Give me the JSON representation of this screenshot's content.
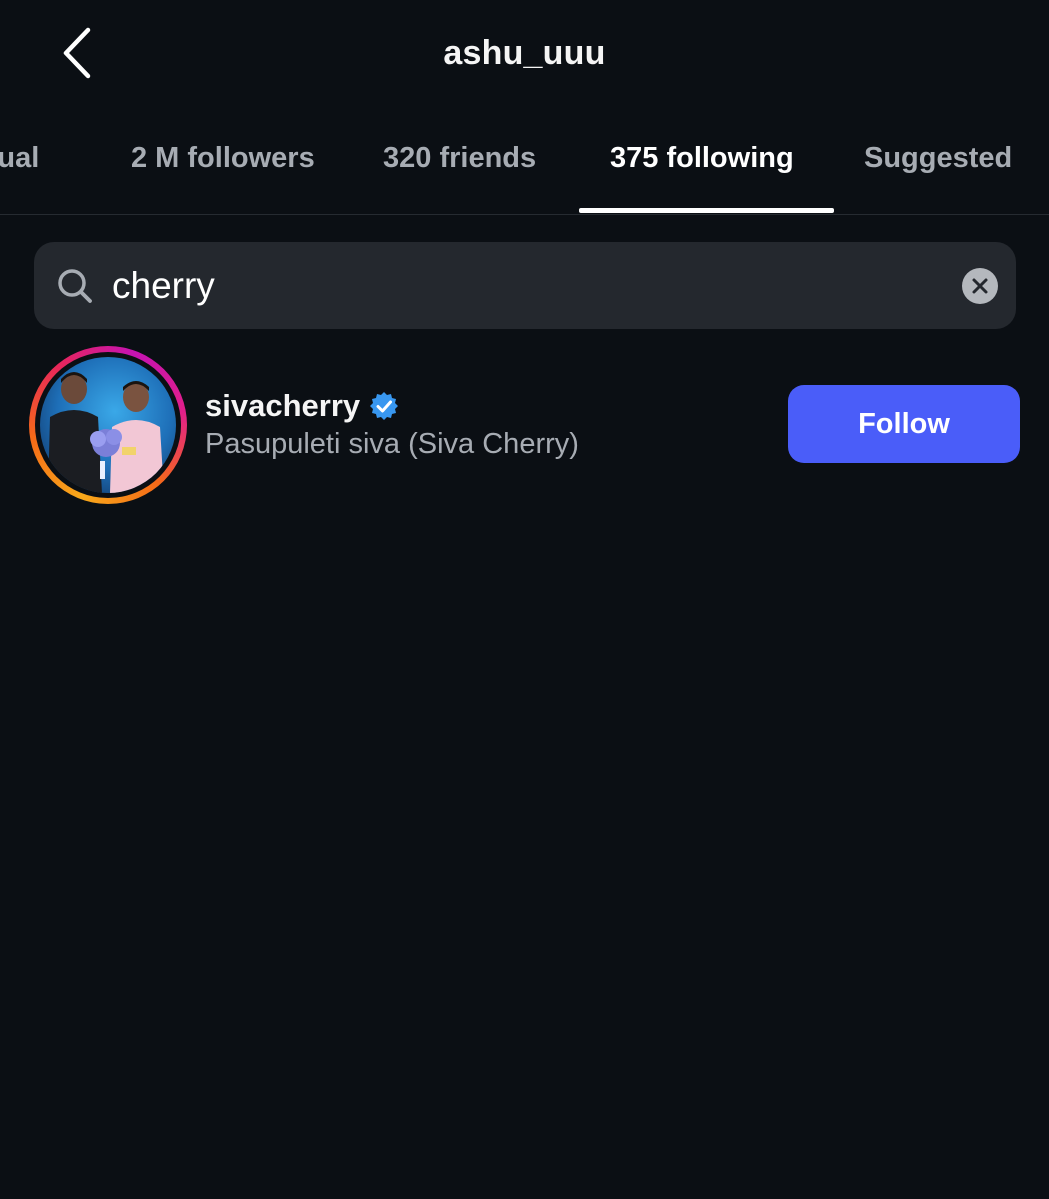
{
  "header": {
    "title": "ashu_uuu"
  },
  "tabs": [
    {
      "label": "utual",
      "active": false
    },
    {
      "label": "2 M followers",
      "active": false
    },
    {
      "label": "320 friends",
      "active": false
    },
    {
      "label": "375 following",
      "active": true
    },
    {
      "label": "Suggested",
      "active": false
    }
  ],
  "search": {
    "value": "cherry",
    "icon": "search-icon",
    "clear_icon": "clear-icon"
  },
  "results": [
    {
      "username": "sivacherry",
      "verified": true,
      "full_name": "Pasupuleti siva (Siva Cherry)",
      "follow_label": "Follow"
    }
  ],
  "colors": {
    "background": "#0b0f14",
    "accent": "#4a5df9",
    "verified": "#3897f0",
    "search_bg": "#24282e",
    "secondary_text": "#a7acb3"
  }
}
